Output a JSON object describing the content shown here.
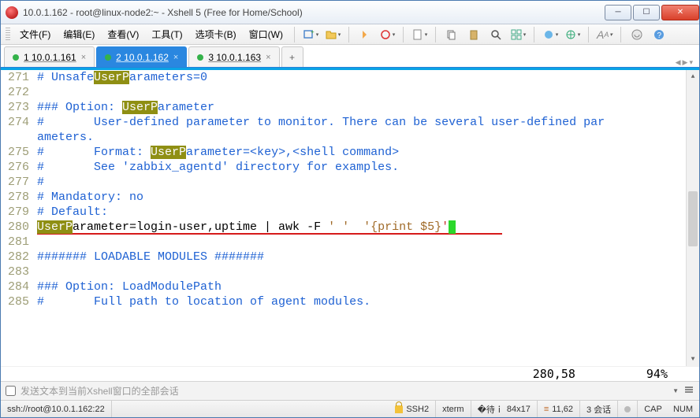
{
  "window": {
    "title": "10.0.1.162 - root@linux-node2:~ - Xshell 5 (Free for Home/School)"
  },
  "menu": {
    "file": "文件(F)",
    "edit": "编辑(E)",
    "view": "查看(V)",
    "tools": "工具(T)",
    "tab": "选项卡(B)",
    "window": "窗口(W)"
  },
  "tabs": [
    {
      "label": "1 10.0.1.161"
    },
    {
      "label": "2 10.0.1.162"
    },
    {
      "label": "3 10.0.1.163"
    }
  ],
  "editor": {
    "lines": [
      {
        "n": "271",
        "seg": [
          {
            "t": "# Unsafe",
            "c": "c-blue"
          },
          {
            "t": "UserP",
            "c": "hl"
          },
          {
            "t": "arameters=0",
            "c": "c-blue"
          }
        ]
      },
      {
        "n": "272",
        "seg": []
      },
      {
        "n": "273",
        "seg": [
          {
            "t": "### Option: ",
            "c": "c-blue"
          },
          {
            "t": "UserP",
            "c": "hl"
          },
          {
            "t": "arameter",
            "c": "c-blue"
          }
        ]
      },
      {
        "n": "274",
        "seg": [
          {
            "t": "#       User-defined parameter to monitor. There can be several user-defined par",
            "c": "c-blue"
          }
        ]
      },
      {
        "n": "",
        "seg": [
          {
            "t": "ameters.",
            "c": "c-blue"
          }
        ]
      },
      {
        "n": "275",
        "seg": [
          {
            "t": "#       Format: ",
            "c": "c-blue"
          },
          {
            "t": "UserP",
            "c": "hl"
          },
          {
            "t": "arameter=<key>,<shell command>",
            "c": "c-blue"
          }
        ]
      },
      {
        "n": "276",
        "seg": [
          {
            "t": "#       See 'zabbix_agentd' directory for examples.",
            "c": "c-blue"
          }
        ]
      },
      {
        "n": "277",
        "seg": [
          {
            "t": "#",
            "c": "c-blue"
          }
        ]
      },
      {
        "n": "278",
        "seg": [
          {
            "t": "# Mandatory: no",
            "c": "c-blue"
          }
        ]
      },
      {
        "n": "279",
        "seg": [
          {
            "t": "# Default:",
            "c": "c-blue"
          }
        ]
      },
      {
        "n": "280",
        "seg": [
          {
            "t": "UserP",
            "c": "hl"
          },
          {
            "t": "arameter=login-user,uptime | awk -F ",
            "c": ""
          },
          {
            "t": "' '  '{print $5}",
            "c": "c-brown"
          },
          {
            "t": "'",
            "c": "c-red"
          },
          {
            "t": "",
            "c": "curs"
          }
        ],
        "underline": true
      },
      {
        "n": "281",
        "seg": []
      },
      {
        "n": "282",
        "seg": [
          {
            "t": "####### LOADABLE MODULES #######",
            "c": "c-blue"
          }
        ]
      },
      {
        "n": "283",
        "seg": []
      },
      {
        "n": "284",
        "seg": [
          {
            "t": "### Option: LoadModulePath",
            "c": "c-blue"
          }
        ]
      },
      {
        "n": "285",
        "seg": [
          {
            "t": "#       Full path to location of agent modules.",
            "c": "c-blue"
          }
        ]
      }
    ],
    "pos": "280,58",
    "pct": "94%"
  },
  "broadcast": {
    "placeholder": "发送文本到当前Xshell窗口的全部会话"
  },
  "status": {
    "conn": "ssh://root@10.0.1.162:22",
    "proto": "SSH2",
    "term": "xterm",
    "size": "84x17",
    "cursor": "11,62",
    "sess": "3 会话",
    "cap": "CAP",
    "num": "NUM"
  }
}
